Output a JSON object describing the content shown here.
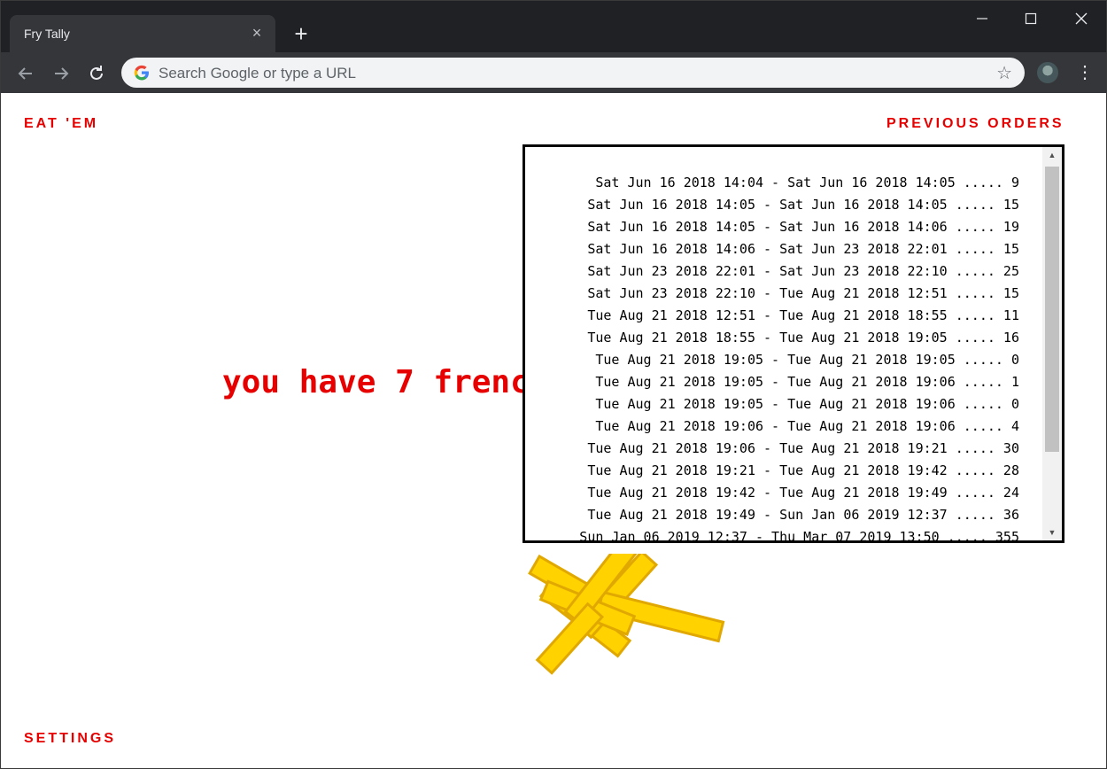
{
  "browser": {
    "tab_title": "Fry Tally",
    "tab_close": "×",
    "new_tab": "+",
    "omnibox_placeholder": "Search Google or type a URL"
  },
  "nav": {
    "eat_label": "EAT 'EM",
    "previous_orders_label": "PREVIOUS ORDERS",
    "settings_label": "SETTINGS"
  },
  "main": {
    "message": "you have 7 frenc"
  },
  "orders": [
    "Sat Jun 16 2018 14:04 - Sat Jun 16 2018 14:05 ..... 9",
    "Sat Jun 16 2018 14:05 - Sat Jun 16 2018 14:05 ..... 15",
    "Sat Jun 16 2018 14:05 - Sat Jun 16 2018 14:06 ..... 19",
    "Sat Jun 16 2018 14:06 - Sat Jun 23 2018 22:01 ..... 15",
    "Sat Jun 23 2018 22:01 - Sat Jun 23 2018 22:10 ..... 25",
    "Sat Jun 23 2018 22:10 - Tue Aug 21 2018 12:51 ..... 15",
    "Tue Aug 21 2018 12:51 - Tue Aug 21 2018 18:55 ..... 11",
    "Tue Aug 21 2018 18:55 - Tue Aug 21 2018 19:05 ..... 16",
    "Tue Aug 21 2018 19:05 - Tue Aug 21 2018 19:05 ..... 0",
    "Tue Aug 21 2018 19:05 - Tue Aug 21 2018 19:06 ..... 1",
    "Tue Aug 21 2018 19:05 - Tue Aug 21 2018 19:06 ..... 0",
    "Tue Aug 21 2018 19:06 - Tue Aug 21 2018 19:06 ..... 4",
    "Tue Aug 21 2018 19:06 - Tue Aug 21 2018 19:21 ..... 30",
    "Tue Aug 21 2018 19:21 - Tue Aug 21 2018 19:42 ..... 28",
    "Tue Aug 21 2018 19:42 - Tue Aug 21 2018 19:49 ..... 24",
    "Tue Aug 21 2018 19:49 - Sun Jan 06 2019 12:37 ..... 36",
    "Sun Jan 06 2019 12:37 - Thu Mar 07 2019 13:50 ..... 355"
  ],
  "colors": {
    "accent": "#e60000",
    "fry_fill": "#ffd200",
    "fry_stroke": "#e0a800"
  },
  "icons": {
    "back": "arrow-left-icon",
    "forward": "arrow-right-icon",
    "reload": "reload-icon",
    "bookmark": "star-icon",
    "menu": "kebab-menu-icon"
  }
}
